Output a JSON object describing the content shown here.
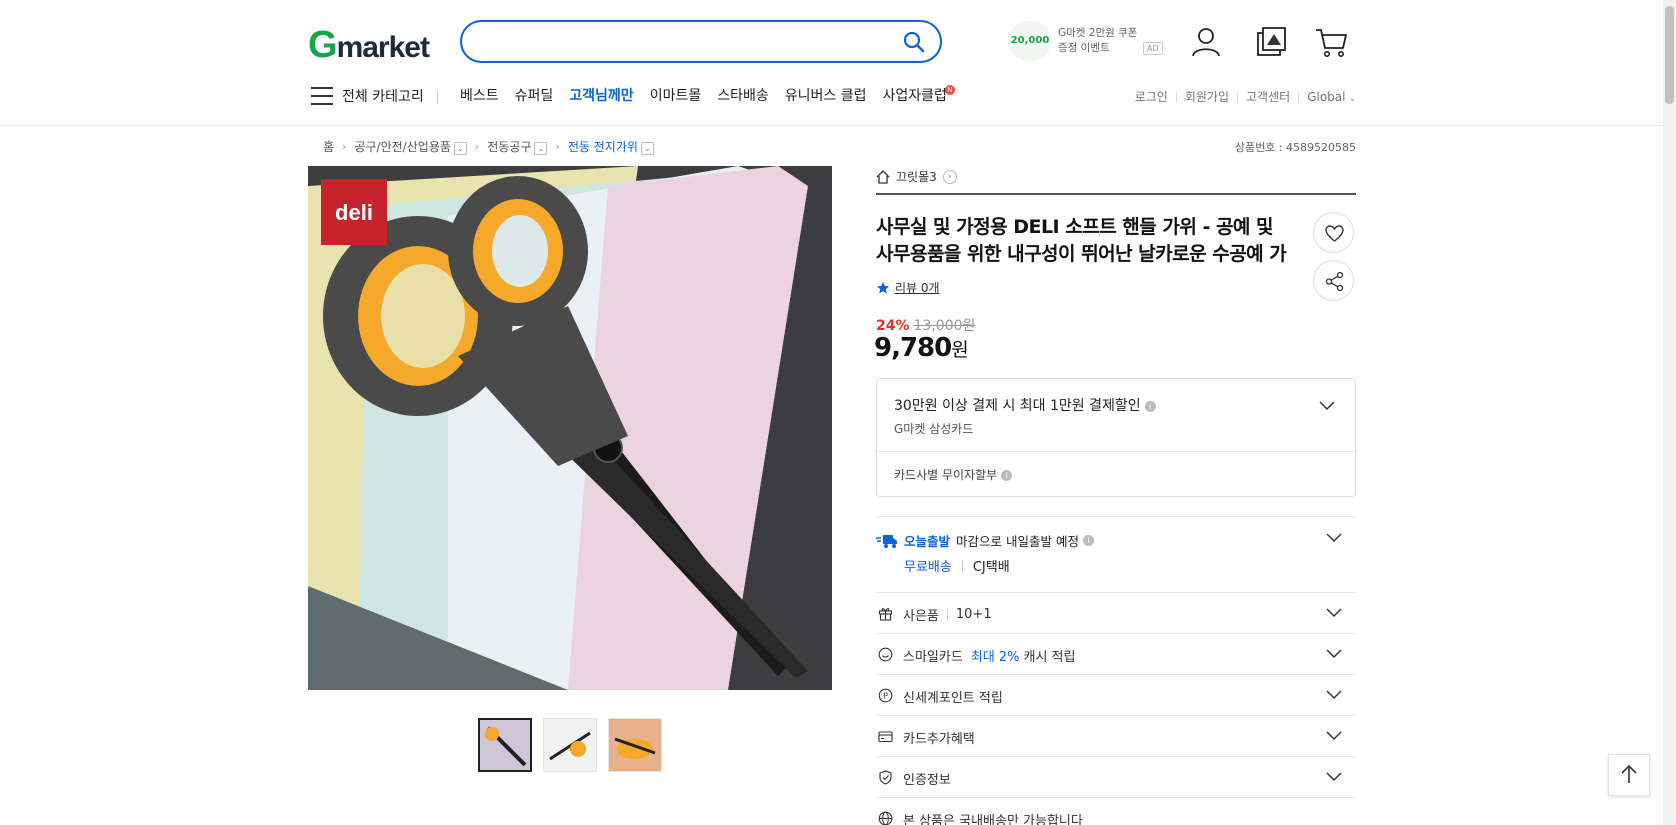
{
  "header": {
    "logo": {
      "g": "G",
      "rest": "market"
    },
    "search": {
      "value": "",
      "placeholder": ""
    },
    "promo": {
      "badge": "20,000",
      "line1": "G마켓 2만원 쿠폰",
      "line2": "증정 이벤트",
      "ad": "AD"
    }
  },
  "nav": {
    "all_categories": "전체 카테고리",
    "items": [
      "베스트",
      "슈퍼딜",
      "고객님께만",
      "이마트몰",
      "스타배송",
      "유니버스 클럽",
      "사업자클럽"
    ],
    "new_badge": "N",
    "util": [
      "로그인",
      "회원가입",
      "고객센터",
      "Global"
    ]
  },
  "breadcrumb": {
    "home": "홈",
    "items": [
      "공구/안전/산업용품",
      "전동공구",
      "전동 전지가위"
    ],
    "product_number": "상품번호 : 4589520585"
  },
  "product": {
    "brand_logo": "deli",
    "shop_name": "끄릿몰3",
    "title": "사무실 및 가정용 DELI 소프트 핸들 가위 - 공예 및 사무용품을 위한 내구성이 뛰어난 날카로운 수공예 가",
    "review": "리뷰 0개",
    "discount": "24%",
    "original_price": "13,000원",
    "price": "9,780",
    "price_unit": "원"
  },
  "card_benefit": {
    "line1": "30만원 이상 결제 시 최대 1만원 결제할인",
    "line2": "G마켓 삼성카드",
    "line3": "카드사별 무이자할부",
    "info": "i"
  },
  "shipping": {
    "today": "오늘출발",
    "today_rest": "마감으로 내일출발 예정",
    "free": "무료배송",
    "courier": "CJ택배"
  },
  "rows": [
    {
      "label": "사은품",
      "extra": "10+1"
    },
    {
      "label": "스마일카드",
      "blue": "최대 2%",
      "rest": "캐시 적립"
    },
    {
      "label": "신세계포인트 적립"
    },
    {
      "label": "카드추가혜택"
    },
    {
      "label": "인증정보"
    },
    {
      "label": "본 상품은 국내배송만 가능합니다"
    }
  ],
  "colors": {
    "accent": "#0b63d6",
    "discount": "#e52e2e",
    "logo_green": "#19a34a"
  }
}
